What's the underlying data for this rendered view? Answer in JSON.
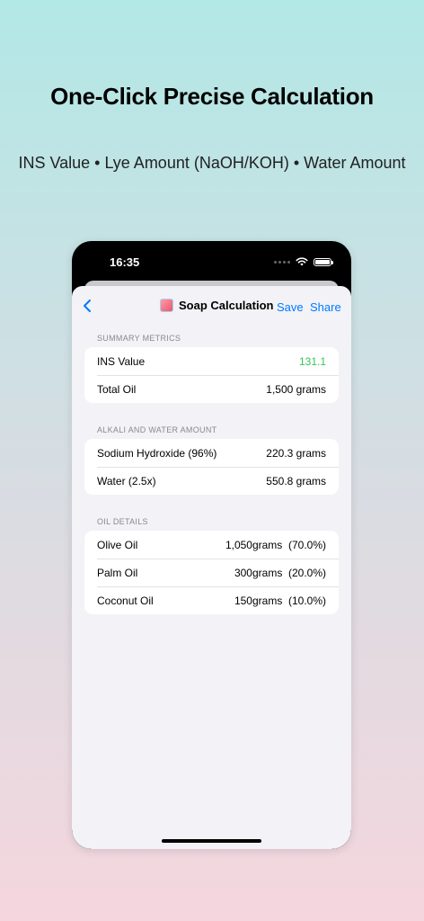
{
  "promo": {
    "headline": "One-Click Precise Calculation",
    "subline": "INS Value • Lye Amount (NaOH/KOH) • Water Amount"
  },
  "status_bar": {
    "time": "16:35",
    "icons": [
      "signal-dots-icon",
      "wifi-icon",
      "battery-icon"
    ]
  },
  "nav": {
    "back_icon": "chevron-left-icon",
    "title": "Soap Calculation",
    "title_icon": "soap-icon",
    "save_label": "Save",
    "share_label": "Share"
  },
  "summary": {
    "header": "SUMMARY METRICS",
    "rows": [
      {
        "label": "INS Value",
        "value": "131.1"
      },
      {
        "label": "Total Oil",
        "value": "1,500 grams"
      }
    ]
  },
  "alkali": {
    "header": "ALKALI AND WATER AMOUNT",
    "rows": [
      {
        "label": "Sodium Hydroxide (96%)",
        "value": "220.3 grams"
      },
      {
        "label": "Water (2.5x)",
        "value": "550.8 grams"
      }
    ]
  },
  "oils": {
    "header": "OIL DETAILS",
    "rows": [
      {
        "label": "Olive Oil",
        "value": "1,050grams  (70.0%)"
      },
      {
        "label": "Palm Oil",
        "value": "300grams  (20.0%)"
      },
      {
        "label": "Coconut Oil",
        "value": "150grams  (10.0%)"
      }
    ]
  },
  "colors": {
    "accent": "#007aff",
    "ins_value": "#34c759",
    "background_top": "#b2e8e6",
    "background_bottom": "#f5d6de"
  }
}
